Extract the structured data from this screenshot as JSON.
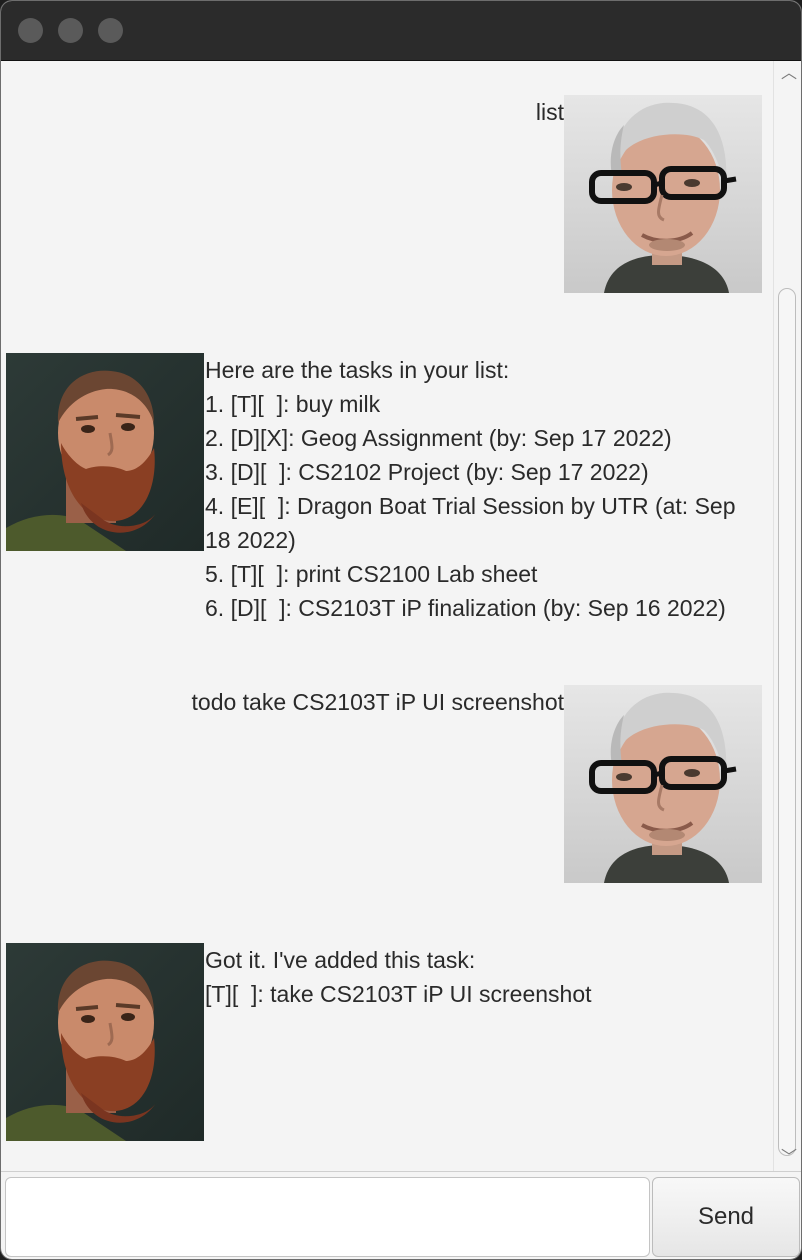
{
  "window": {
    "traffic_lights": [
      "close",
      "minimize",
      "zoom"
    ]
  },
  "chat": {
    "messages": [
      {
        "sender": "user",
        "avatar": "user-avatar-icon",
        "text": "list"
      },
      {
        "sender": "bot",
        "avatar": "bot-avatar-icon",
        "lines": [
          "Here are the tasks in your list:",
          "1. [T][  ]: buy milk",
          "2. [D][X]: Geog Assignment (by: Sep 17 2022)",
          "3. [D][  ]: CS2102 Project (by: Sep 17 2022)",
          "4. [E][  ]: Dragon Boat Trial Session by UTR (at: Sep",
          "18 2022)",
          "5. [T][  ]: print CS2100 Lab sheet",
          "6. [D][  ]: CS2103T iP finalization (by: Sep 16 2022)"
        ]
      },
      {
        "sender": "user",
        "avatar": "user-avatar-icon",
        "text": "todo take CS2103T iP UI screenshot"
      },
      {
        "sender": "bot",
        "avatar": "bot-avatar-icon",
        "lines": [
          "Got it. I've added this task:",
          "[T][  ]: take CS2103T iP UI screenshot"
        ]
      }
    ]
  },
  "input": {
    "value": "",
    "placeholder": ""
  },
  "send_button": {
    "label": "Send"
  },
  "colors": {
    "titlebar": "#2b2b2b",
    "background": "#f4f4f4",
    "text": "#2a2a2a"
  }
}
